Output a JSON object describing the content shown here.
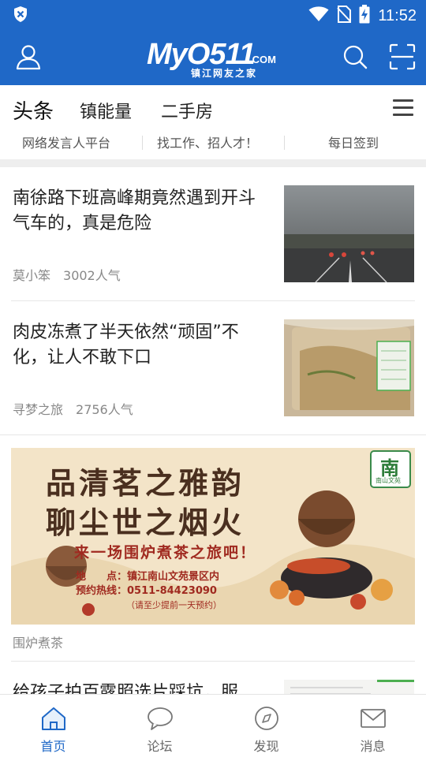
{
  "status_bar": {
    "time": "11:52"
  },
  "header": {
    "logo_main": "MyO511",
    "logo_com": ".COM",
    "logo_sub": "镇江网友之家"
  },
  "tabs": [
    {
      "label": "头条",
      "active": true
    },
    {
      "label": "镇能量",
      "active": false
    },
    {
      "label": "二手房",
      "active": false
    }
  ],
  "quick_links": [
    "网络发言人平台",
    "找工作、招人才！",
    "每日签到"
  ],
  "articles": [
    {
      "title": "南徐路下班高峰期竟然遇到开斗气车的，真是危险",
      "author": "莫小笨",
      "popularity": "3002人气"
    },
    {
      "title": "肉皮冻煮了半天依然“顽固”不化，让人不敢下口",
      "author": "寻梦之旅",
      "popularity": "2756人气"
    },
    {
      "title": "给孩子拍百露照选片踩坑，服",
      "author": "",
      "popularity": ""
    }
  ],
  "banner": {
    "headline_1": "品清茗之雅韵",
    "headline_2": "聊尘世之烟火",
    "slogan": "来一场围炉煮茶之旅吧！",
    "address_label": "地　　点：",
    "address": "镇江南山文苑景区内",
    "hotline_label": "预约热线：",
    "hotline": "0511-84423090",
    "note": "（请至少提前一天预约）",
    "badge": "南",
    "badge_sub": "南山文苑",
    "caption": "围炉煮茶"
  },
  "bottom_nav": [
    {
      "label": "首页",
      "icon": "home-icon",
      "active": true
    },
    {
      "label": "论坛",
      "icon": "chat-bubble-icon",
      "active": false
    },
    {
      "label": "发现",
      "icon": "compass-icon",
      "active": false
    },
    {
      "label": "消息",
      "icon": "mail-icon",
      "active": false
    }
  ],
  "colors": {
    "brand_blue": "#1f68c7",
    "text_dark": "#222222",
    "text_muted": "#888888"
  }
}
